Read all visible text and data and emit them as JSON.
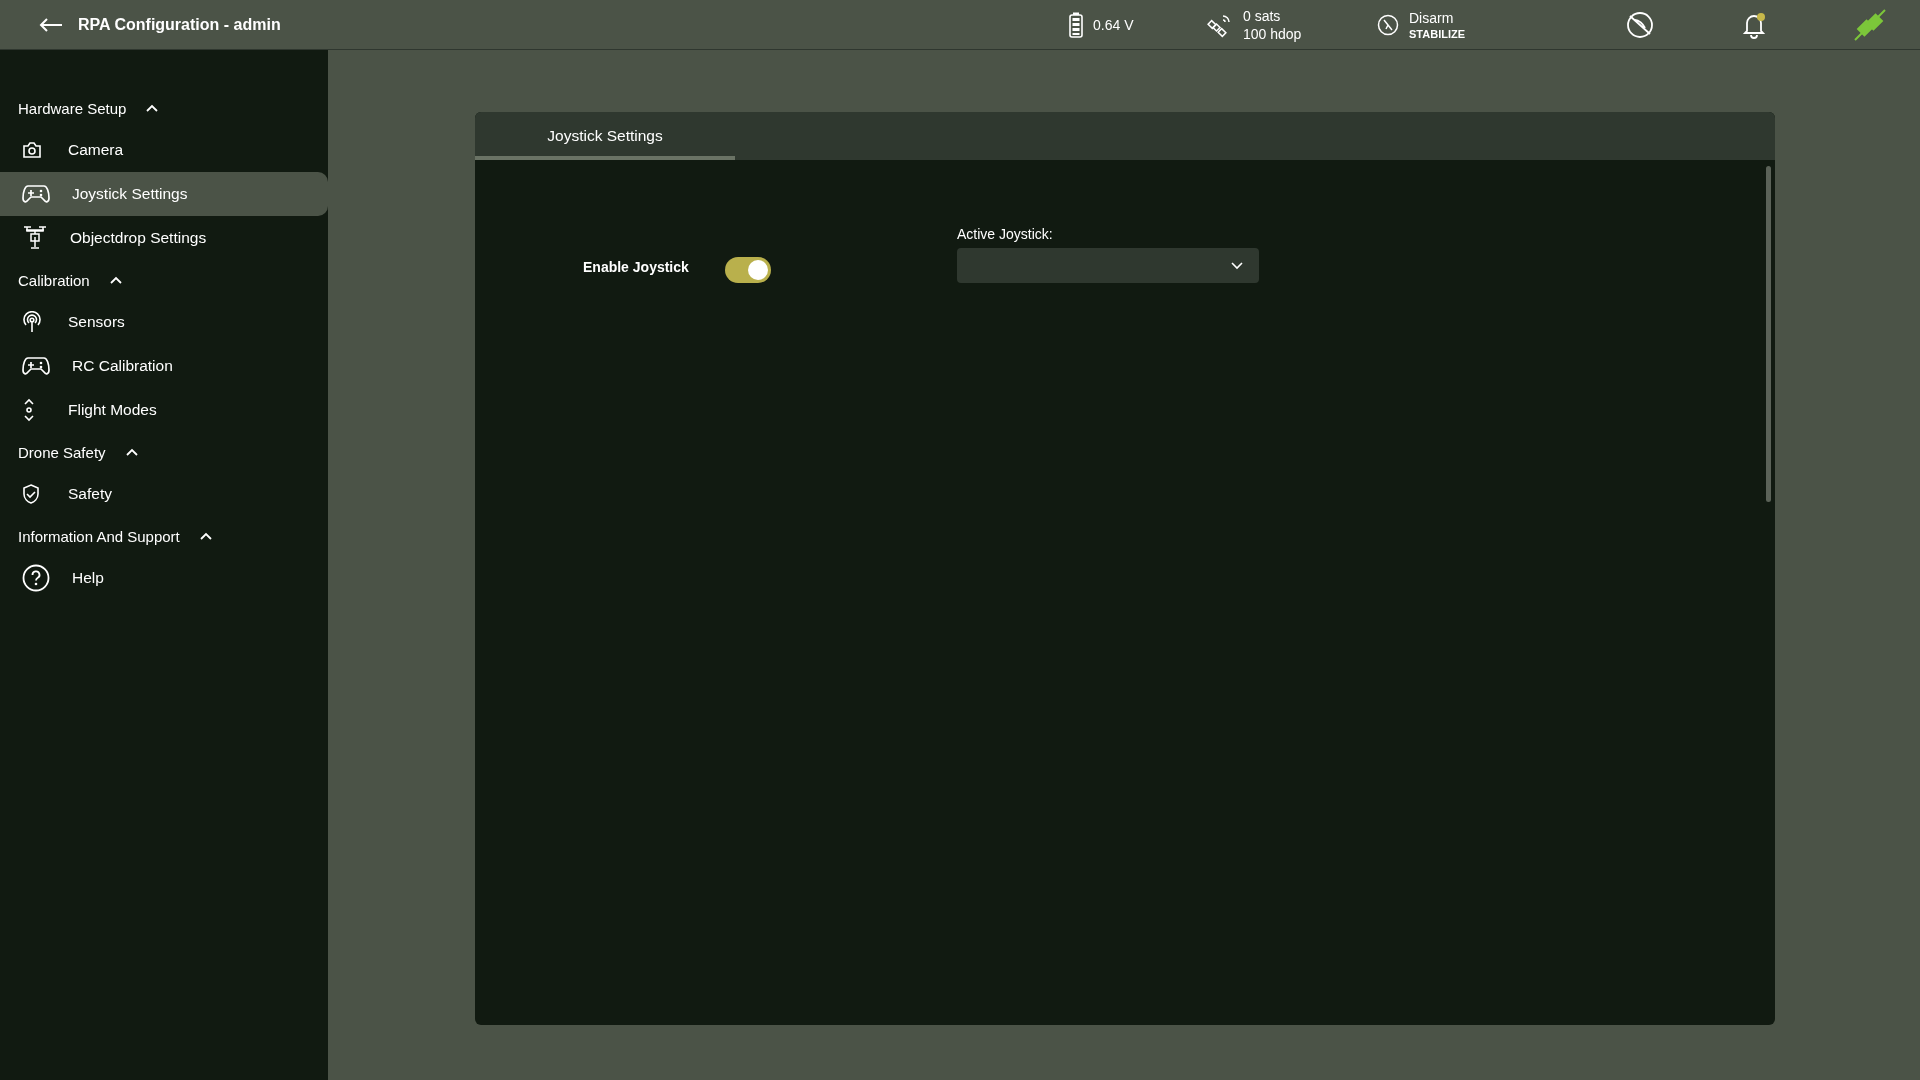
{
  "window": {
    "title": "RPA Configuration - admin"
  },
  "status": {
    "battery": "0.64 V",
    "gps_sats": "0 sats",
    "gps_hdop": "100 hdop",
    "arm_state": "Disarm",
    "flight_mode": "STABILIZE",
    "notification_unread": true,
    "connected": true
  },
  "sidebar": {
    "sections": [
      {
        "label": "Hardware Setup",
        "expanded": true,
        "items": [
          {
            "label": "Camera",
            "selected": false
          },
          {
            "label": "Joystick Settings",
            "selected": true
          },
          {
            "label": "Objectdrop Settings",
            "selected": false
          }
        ]
      },
      {
        "label": "Calibration",
        "expanded": true,
        "items": [
          {
            "label": "Sensors",
            "selected": false
          },
          {
            "label": "RC Calibration",
            "selected": false
          },
          {
            "label": "Flight Modes",
            "selected": false
          }
        ]
      },
      {
        "label": "Drone Safety",
        "expanded": true,
        "items": [
          {
            "label": "Safety",
            "selected": false
          }
        ]
      },
      {
        "label": "Information And Support",
        "expanded": true,
        "items": [
          {
            "label": "Help",
            "selected": false
          }
        ]
      }
    ]
  },
  "panel": {
    "tabs": [
      {
        "label": "Joystick Settings",
        "selected": true
      }
    ],
    "enable_joystick": {
      "label": "Enable Joystick",
      "on": true
    },
    "active_joystick": {
      "label": "Active Joystick:"
    }
  }
}
